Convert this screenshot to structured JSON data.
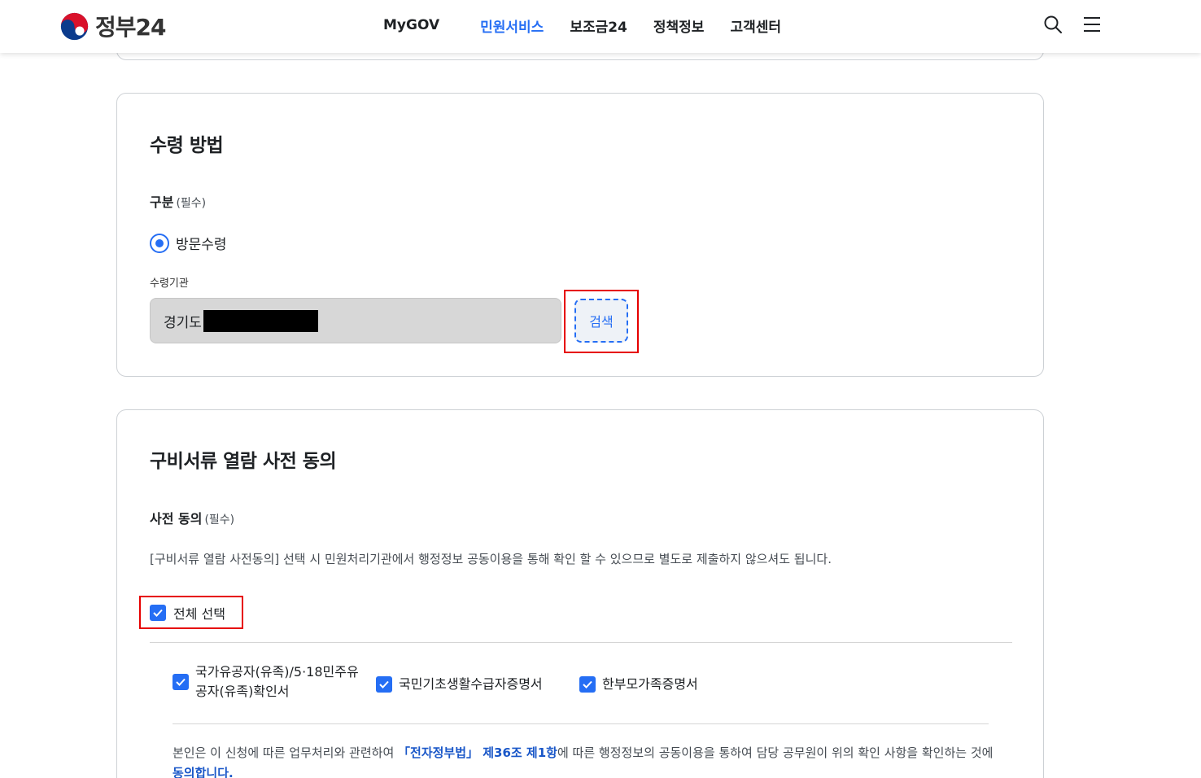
{
  "header": {
    "logo_text": "정부24",
    "nav": [
      "MyGOV",
      "민원서비스",
      "보조금24",
      "정책정보",
      "고객센터"
    ],
    "active_nav": "민원서비스",
    "accent": "#256ef4"
  },
  "receipt": {
    "title": "수령 방법",
    "category_label": "구분",
    "required_tag": "(필수)",
    "option_label": "방문수령",
    "agency_label": "수령기관",
    "agency_value": "경기도",
    "search_button": "검색"
  },
  "consent": {
    "title": "구비서류 열람 사전 동의",
    "label": "사전 동의",
    "required_tag": "(필수)",
    "description": "[구비서류 열람 사전동의] 선택 시 민원처리기관에서 행정정보 공동이용을 통해 확인 할 수 있으므로 별도로 제출하지 않으셔도 됩니다.",
    "select_all": "전체 선택",
    "items": [
      "국가유공자(유족)/5·18민주유공자(유족)확인서",
      "국민기초생활수급자증명서",
      "한부모가족증명서"
    ],
    "notice_pre": "본인은 이 신청에 따른 업무처리와 관련하여 ",
    "notice_law": "「전자정부법」 제36조 제1항",
    "notice_mid": "에 따른 행정정보의 공동이용을 통하여 담당 공무원이 위의 확인 사항을 확인하는 것에 ",
    "notice_agree": "동의합니다."
  }
}
